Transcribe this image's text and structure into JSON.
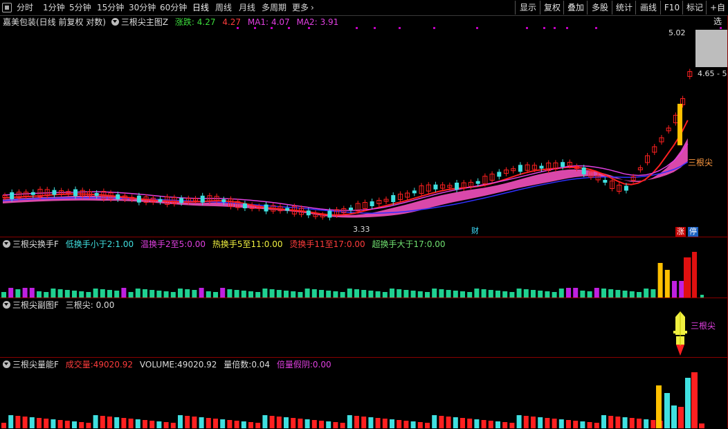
{
  "toolbar": {
    "periods": [
      "分时",
      "1分钟",
      "5分钟",
      "15分钟",
      "30分钟",
      "60分钟",
      "日线",
      "周线",
      "月线",
      "多周期",
      "更多"
    ],
    "active_period": "日线",
    "right_buttons": [
      "显示",
      "复权",
      "叠加",
      "多股",
      "统计",
      "画线",
      "F10",
      "标记",
      "+自选"
    ]
  },
  "main_pane": {
    "stock_name": "嘉美包装(日线 前复权 对数)",
    "indicator": "三根尖主图Z",
    "change_label": "涨跌:",
    "change_value": "4.27",
    "close_value": "4.27",
    "ma1_label": "MA1:",
    "ma1_value": "4.07",
    "ma2_label": "MA2:",
    "ma2_value": "3.91",
    "price_high": "5.02",
    "price_mark": "4.65 - 5",
    "low_label": "3.33",
    "tag_finance": "财",
    "tag_zhang": "涨",
    "tag_ting": "停",
    "signal_label": "三根尖",
    "colors": {
      "up": "#ff2020",
      "down": "#40e0e0",
      "ma_red": "#ff2020",
      "ma_mag": "#e040e0",
      "band": "#ff55c8"
    }
  },
  "turnover_pane": {
    "indicator": "三根尖换手F",
    "items": [
      {
        "label": "低换手小于2:",
        "value": "1.00",
        "color": "#40e0e0"
      },
      {
        "label": "温换手2至5:",
        "value": "0.00",
        "color": "#e040e0"
      },
      {
        "label": "热换手5至11:",
        "value": "0.00",
        "color": "#f0f040"
      },
      {
        "label": "烫换手11至17:",
        "value": "0.00",
        "color": "#ff3c3c"
      },
      {
        "label": "超换手大于17:",
        "value": "0.00",
        "color": "#3cdc3c"
      }
    ]
  },
  "sub_pane": {
    "indicator": "三根尖副图F",
    "label": "三根尖:",
    "value": "0.00",
    "signal_text": "三根尖"
  },
  "volume_pane": {
    "indicator": "三根尖量能F",
    "vol_label": "成交量:",
    "vol_value": "49020.92",
    "volume_label": "VOLUME:",
    "volume_value": "49020.92",
    "ratio_label": "量倍数:",
    "ratio_value": "0.04",
    "double_label": "倍量假阴:",
    "double_value": "0.00"
  }
}
